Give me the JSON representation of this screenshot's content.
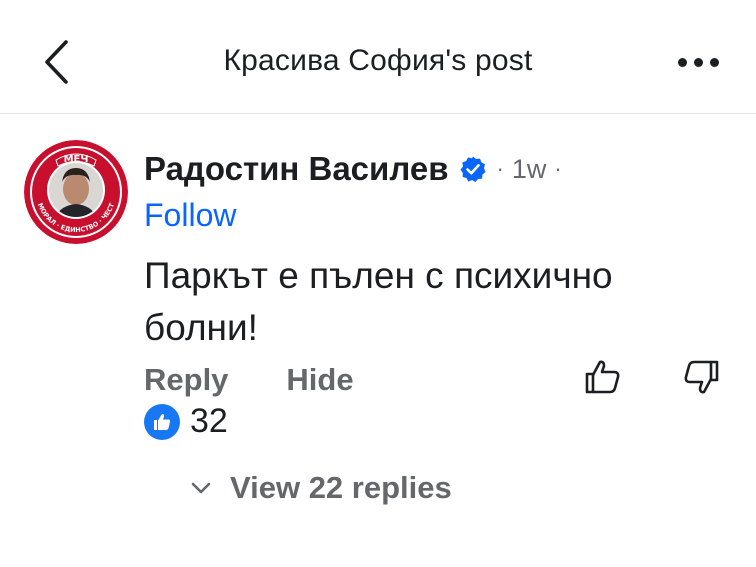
{
  "header": {
    "title": "Красива София's post",
    "back_icon": "chevron-left-icon",
    "more_icon": "more-horizontal-icon"
  },
  "comment": {
    "author": {
      "name": "Радостин Василев",
      "verified": true,
      "avatar_badge_top": "МЕЧ",
      "avatar_badge_ring": "МОРАЛ · ЕДИНСТВО · ЧЕСТ"
    },
    "time": "1w",
    "separator": "·",
    "follow_label": "Follow",
    "text": "Паркът е пълен с психично болни!",
    "actions": {
      "reply_label": "Reply",
      "hide_label": "Hide"
    },
    "reactions": {
      "type": "like",
      "count": "32"
    },
    "view_replies_label": "View 22 replies"
  },
  "colors": {
    "link": "#0866ff",
    "muted": "#65676b",
    "text": "#1c1e21",
    "like": "#1877f2",
    "badge_red": "#c8102e"
  }
}
